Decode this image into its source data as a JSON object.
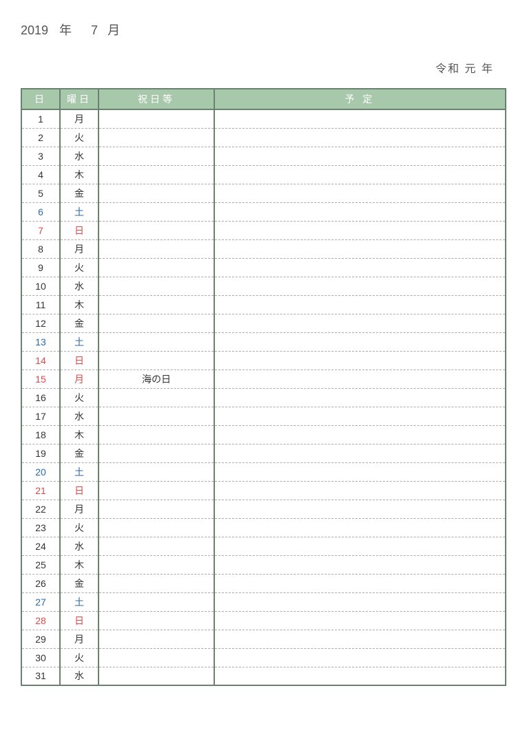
{
  "header": {
    "year": "2019",
    "year_label": "年",
    "month": "7",
    "month_label": "月",
    "era": "令和  元  年"
  },
  "columns": {
    "day": "日",
    "dow": "曜日",
    "holiday": "祝日等",
    "plan": "予 定"
  },
  "rows": [
    {
      "day": "1",
      "dow": "月",
      "holiday": "",
      "plan": "",
      "type": "weekday"
    },
    {
      "day": "2",
      "dow": "火",
      "holiday": "",
      "plan": "",
      "type": "weekday"
    },
    {
      "day": "3",
      "dow": "水",
      "holiday": "",
      "plan": "",
      "type": "weekday"
    },
    {
      "day": "4",
      "dow": "木",
      "holiday": "",
      "plan": "",
      "type": "weekday"
    },
    {
      "day": "5",
      "dow": "金",
      "holiday": "",
      "plan": "",
      "type": "weekday"
    },
    {
      "day": "6",
      "dow": "土",
      "holiday": "",
      "plan": "",
      "type": "sat"
    },
    {
      "day": "7",
      "dow": "日",
      "holiday": "",
      "plan": "",
      "type": "sun"
    },
    {
      "day": "8",
      "dow": "月",
      "holiday": "",
      "plan": "",
      "type": "weekday"
    },
    {
      "day": "9",
      "dow": "火",
      "holiday": "",
      "plan": "",
      "type": "weekday"
    },
    {
      "day": "10",
      "dow": "水",
      "holiday": "",
      "plan": "",
      "type": "weekday"
    },
    {
      "day": "11",
      "dow": "木",
      "holiday": "",
      "plan": "",
      "type": "weekday"
    },
    {
      "day": "12",
      "dow": "金",
      "holiday": "",
      "plan": "",
      "type": "weekday"
    },
    {
      "day": "13",
      "dow": "土",
      "holiday": "",
      "plan": "",
      "type": "sat"
    },
    {
      "day": "14",
      "dow": "日",
      "holiday": "",
      "plan": "",
      "type": "sun"
    },
    {
      "day": "15",
      "dow": "月",
      "holiday": "海の日",
      "plan": "",
      "type": "hol"
    },
    {
      "day": "16",
      "dow": "火",
      "holiday": "",
      "plan": "",
      "type": "weekday"
    },
    {
      "day": "17",
      "dow": "水",
      "holiday": "",
      "plan": "",
      "type": "weekday"
    },
    {
      "day": "18",
      "dow": "木",
      "holiday": "",
      "plan": "",
      "type": "weekday"
    },
    {
      "day": "19",
      "dow": "金",
      "holiday": "",
      "plan": "",
      "type": "weekday"
    },
    {
      "day": "20",
      "dow": "土",
      "holiday": "",
      "plan": "",
      "type": "sat"
    },
    {
      "day": "21",
      "dow": "日",
      "holiday": "",
      "plan": "",
      "type": "sun"
    },
    {
      "day": "22",
      "dow": "月",
      "holiday": "",
      "plan": "",
      "type": "weekday"
    },
    {
      "day": "23",
      "dow": "火",
      "holiday": "",
      "plan": "",
      "type": "weekday"
    },
    {
      "day": "24",
      "dow": "水",
      "holiday": "",
      "plan": "",
      "type": "weekday"
    },
    {
      "day": "25",
      "dow": "木",
      "holiday": "",
      "plan": "",
      "type": "weekday"
    },
    {
      "day": "26",
      "dow": "金",
      "holiday": "",
      "plan": "",
      "type": "weekday"
    },
    {
      "day": "27",
      "dow": "土",
      "holiday": "",
      "plan": "",
      "type": "sat"
    },
    {
      "day": "28",
      "dow": "日",
      "holiday": "",
      "plan": "",
      "type": "sun"
    },
    {
      "day": "29",
      "dow": "月",
      "holiday": "",
      "plan": "",
      "type": "weekday"
    },
    {
      "day": "30",
      "dow": "火",
      "holiday": "",
      "plan": "",
      "type": "weekday"
    },
    {
      "day": "31",
      "dow": "水",
      "holiday": "",
      "plan": "",
      "type": "weekday"
    }
  ]
}
